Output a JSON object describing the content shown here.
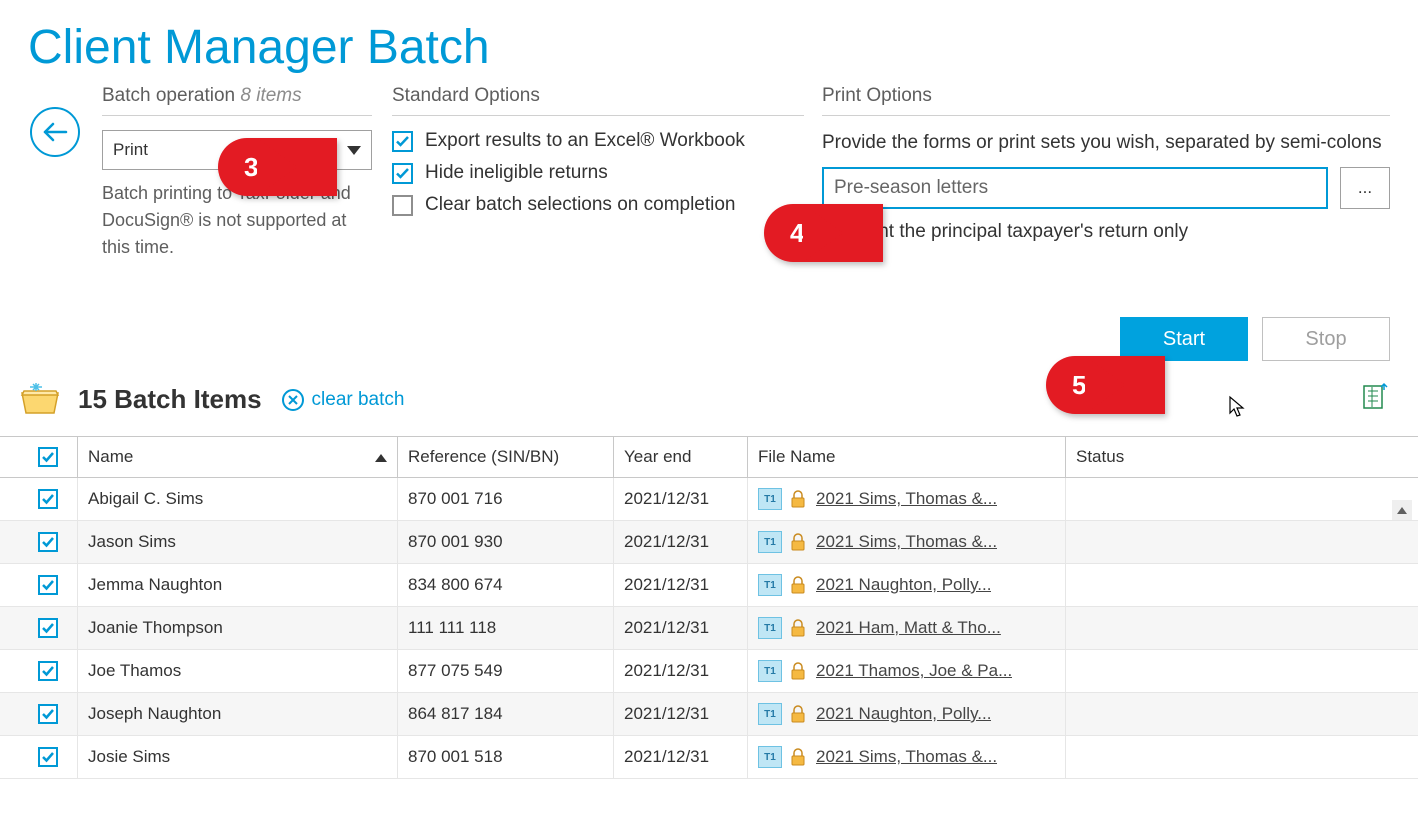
{
  "page_title": "Client Manager Batch",
  "batch_operation": {
    "label": "Batch operation",
    "item_count": "8 items",
    "selected": "Print",
    "help_text": "Batch printing to TaxFolder and DocuSign® is not supported at this time."
  },
  "standard_options": {
    "title": "Standard Options",
    "opts": [
      {
        "label": "Export results to an Excel® Workbook",
        "checked": true
      },
      {
        "label": "Hide ineligible returns",
        "checked": true
      },
      {
        "label": "Clear batch selections on completion",
        "checked": false
      }
    ]
  },
  "print_options": {
    "title": "Print Options",
    "instruction": "Provide the forms or print sets you wish, separated by semi-colons",
    "input_value": "Pre-season letters",
    "more_label": "...",
    "principal_only_label": "Print the principal taxpayer's return only",
    "principal_only_checked": false
  },
  "buttons": {
    "start": "Start",
    "stop": "Stop"
  },
  "batch_items_header": {
    "title": "15 Batch Items",
    "clear_label": "clear batch"
  },
  "columns": {
    "name": "Name",
    "reference": "Reference (SIN/BN)",
    "yearend": "Year end",
    "filename": "File Name",
    "status": "Status"
  },
  "rows": [
    {
      "checked": true,
      "name": "Abigail C. Sims",
      "ref": "870 001 716",
      "yearend": "2021/12/31",
      "file": "2021 Sims, Thomas &...",
      "status": ""
    },
    {
      "checked": true,
      "name": "Jason Sims",
      "ref": "870 001 930",
      "yearend": "2021/12/31",
      "file": "2021 Sims, Thomas &...",
      "status": ""
    },
    {
      "checked": true,
      "name": "Jemma Naughton",
      "ref": "834 800 674",
      "yearend": "2021/12/31",
      "file": "2021 Naughton, Polly...",
      "status": ""
    },
    {
      "checked": true,
      "name": "Joanie Thompson",
      "ref": "111 111 118",
      "yearend": "2021/12/31",
      "file": "2021 Ham, Matt & Tho...",
      "status": ""
    },
    {
      "checked": true,
      "name": "Joe Thamos",
      "ref": "877 075 549",
      "yearend": "2021/12/31",
      "file": "2021 Thamos, Joe & Pa...",
      "status": ""
    },
    {
      "checked": true,
      "name": "Joseph Naughton",
      "ref": "864 817 184",
      "yearend": "2021/12/31",
      "file": "2021 Naughton, Polly...",
      "status": ""
    },
    {
      "checked": true,
      "name": "Josie Sims",
      "ref": "870 001 518",
      "yearend": "2021/12/31",
      "file": "2021 Sims, Thomas &...",
      "status": ""
    }
  ],
  "callouts": {
    "c3": "3",
    "c4": "4",
    "c5": "5"
  }
}
